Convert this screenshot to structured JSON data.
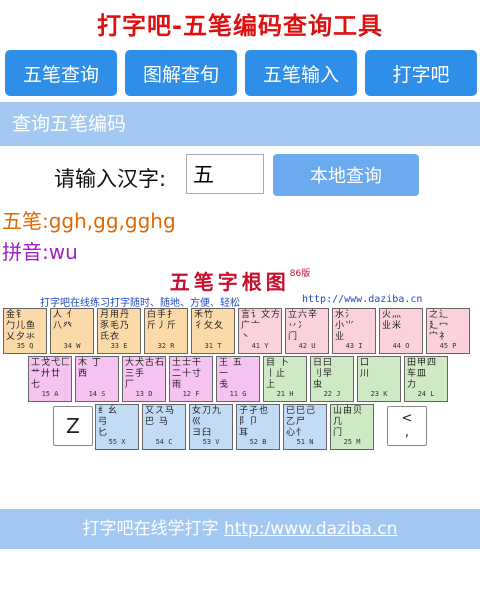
{
  "page": {
    "title": "打字吧-五笔编码查询工具"
  },
  "nav": [
    {
      "label": "五笔查询"
    },
    {
      "label": "图解查旬"
    },
    {
      "label": "五笔输入"
    },
    {
      "label": "打字吧"
    }
  ],
  "section": {
    "title": "查询五笔编码"
  },
  "query": {
    "label": "请输入汉字:",
    "value": "五",
    "button": "本地查询"
  },
  "result": {
    "wubi": "五笔:ggh,gg,gghg",
    "pinyin": "拼音:wu"
  },
  "chart": {
    "title": "五笔字根图",
    "version": "86版",
    "subtitle": "打字吧在线练习打字随时、随地、方便、轻松",
    "url": "http://www.daziba.cn",
    "rows": [
      [
        {
          "glyphs": "金钅\n勹儿鱼\n乂夕氺",
          "code": "35 Q",
          "zone": "orange"
        },
        {
          "glyphs": "人 亻\n八癶",
          "code": "34 W",
          "zone": "orange"
        },
        {
          "glyphs": "月用丹\n豕毛乃\n氏衣",
          "code": "33 E",
          "zone": "orange"
        },
        {
          "glyphs": "白手扌\n斤丿斤",
          "code": "32 R",
          "zone": "orange"
        },
        {
          "glyphs": "禾竹\n彳攵夂",
          "code": "31 T",
          "zone": "orange"
        },
        {
          "glyphs": "言讠文方\n广亠\n丶",
          "code": "41 Y",
          "zone": "pink"
        },
        {
          "glyphs": "立六辛\n丷冫\n门",
          "code": "42 U",
          "zone": "pink"
        },
        {
          "glyphs": "水氵\n小⺌\n业",
          "code": "43 I",
          "zone": "pink"
        },
        {
          "glyphs": "火灬\n业米",
          "code": "44 O",
          "zone": "pink"
        },
        {
          "glyphs": "之辶\n廴冖\n宀礻",
          "code": "45 P",
          "zone": "pink"
        }
      ],
      [
        {
          "glyphs": "工戈弋匚\n艹廾廿\n七",
          "code": "15 A",
          "zone": "violet"
        },
        {
          "glyphs": "木 丁\n西",
          "code": "14 S",
          "zone": "violet"
        },
        {
          "glyphs": "大犬古石\n三手\n厂",
          "code": "13 D",
          "zone": "violet"
        },
        {
          "glyphs": "土士干\n二十寸\n雨",
          "code": "12 F",
          "zone": "violet"
        },
        {
          "glyphs": "王 五\n一\n戋",
          "code": "11 G",
          "zone": "violet"
        },
        {
          "glyphs": "目 卜\n丨止\n上",
          "code": "21 H",
          "zone": "green"
        },
        {
          "glyphs": "日曰\n刂早\n虫",
          "code": "22 J",
          "zone": "green"
        },
        {
          "glyphs": "口\n川",
          "code": "23 K",
          "zone": "green"
        },
        {
          "glyphs": "田甲四\n车皿\n力",
          "code": "24 L",
          "zone": "green"
        }
      ],
      [
        {
          "glyphs": "纟幺\n弓\n匕",
          "code": "55 X",
          "zone": "blue"
        },
        {
          "glyphs": "又ス马\n巴 马",
          "code": "54 C",
          "zone": "blue"
        },
        {
          "glyphs": "女刀九\n巛\nヨ臼",
          "code": "53 V",
          "zone": "blue"
        },
        {
          "glyphs": "子孑也\n阝卩\n耳",
          "code": "52 B",
          "zone": "blue"
        },
        {
          "glyphs": "已巳己\n乙尸\n心忄",
          "code": "51 N",
          "zone": "blue"
        },
        {
          "glyphs": "山由贝\n几\n门",
          "code": "25 M",
          "zone": "green"
        }
      ]
    ],
    "white_keys": {
      "z": "Z",
      "comma": "<\n,"
    }
  },
  "footer": {
    "text": "打字吧在线学打字",
    "link": "http:/www.daziba.cn"
  },
  "colors": {
    "orange": "#fcd9a8",
    "pink": "#fbd2dc",
    "violet": "#f6c2f0",
    "green": "#cfe9c4",
    "blue": "#c2dbf6",
    "nav": "#2f8ee8",
    "band": "#a3c8f2"
  }
}
